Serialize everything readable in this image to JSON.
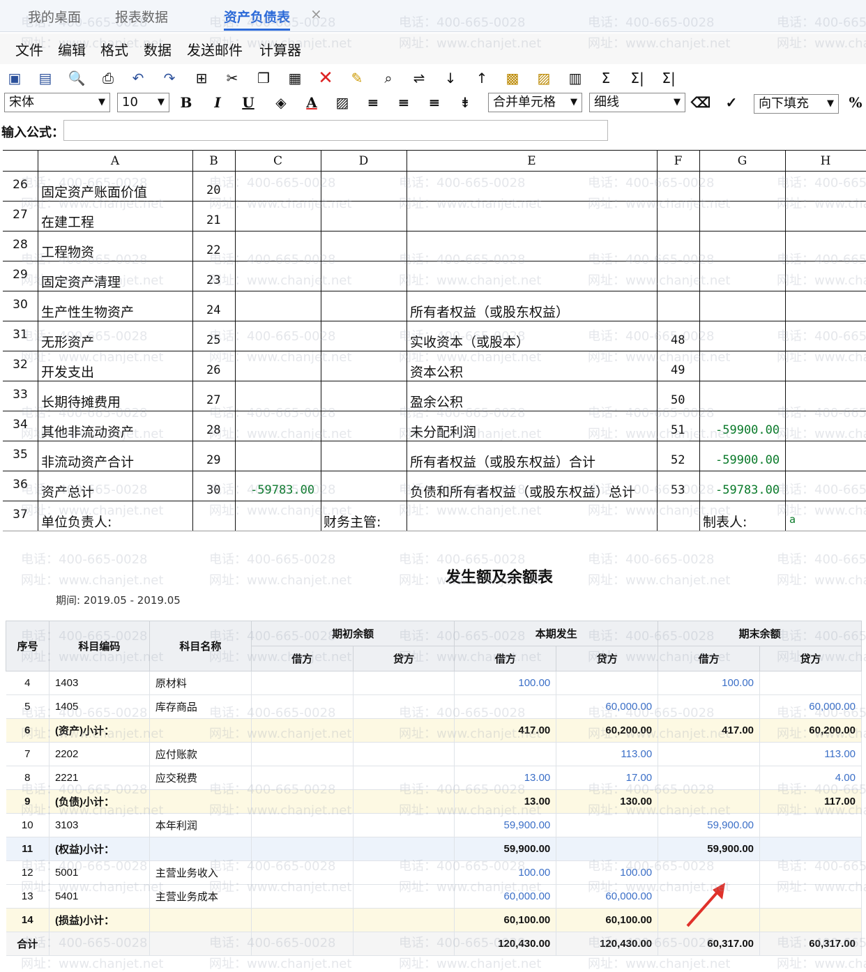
{
  "tabs": [
    {
      "label": "我的桌面"
    },
    {
      "label": "报表数据"
    },
    {
      "label": "资产负债表"
    }
  ],
  "tab_close": "×",
  "menu": [
    "文件",
    "编辑",
    "格式",
    "数据",
    "发送邮件",
    "计算器"
  ],
  "toolbar": {
    "font_name": "宋体",
    "font_size": "10",
    "bold": "B",
    "italic": "I",
    "underline": "U",
    "font_color": "A",
    "merge": "合并单元格",
    "border": "细线",
    "fill": "向下填充",
    "percent": "%",
    "sum1": "Σ",
    "sum2": "Σ|",
    "sum3": "Σ|"
  },
  "formula": {
    "label": "输入公式：",
    "value": ""
  },
  "columns": [
    "A",
    "B",
    "C",
    "D",
    "E",
    "F",
    "G",
    "H"
  ],
  "sheet_rows": [
    {
      "n": "26",
      "a": "固定资产账面价值",
      "b": "20",
      "c": "",
      "e": "",
      "f": "",
      "g": ""
    },
    {
      "n": "27",
      "a": "在建工程",
      "b": "21",
      "c": "",
      "e": "",
      "f": "",
      "g": ""
    },
    {
      "n": "28",
      "a": "工程物资",
      "b": "22",
      "c": "",
      "e": "",
      "f": "",
      "g": ""
    },
    {
      "n": "29",
      "a": "固定资产清理",
      "b": "23",
      "c": "",
      "e": "",
      "f": "",
      "g": ""
    },
    {
      "n": "30",
      "a": "生产性生物资产",
      "b": "24",
      "c": "",
      "e": "所有者权益（或股东权益）",
      "f": "",
      "g": ""
    },
    {
      "n": "31",
      "a": "无形资产",
      "b": "25",
      "c": "",
      "e": "实收资本（或股本）",
      "f": "48",
      "g": ""
    },
    {
      "n": "32",
      "a": "开发支出",
      "b": "26",
      "c": "",
      "e": "资本公积",
      "f": "49",
      "g": ""
    },
    {
      "n": "33",
      "a": "长期待摊费用",
      "b": "27",
      "c": "",
      "e": "盈余公积",
      "f": "50",
      "g": ""
    },
    {
      "n": "34",
      "a": "其他非流动资产",
      "b": "28",
      "c": "",
      "e": "未分配利润",
      "f": "51",
      "g": "-59900.00"
    },
    {
      "n": "35",
      "a": "非流动资产合计",
      "b": "29",
      "c": "",
      "e": "所有者权益（或股东权益）合计",
      "f": "52",
      "g": "-59900.00"
    },
    {
      "n": "36",
      "a": "资产总计",
      "b": "30",
      "c": "-59783.00",
      "e": "负债和所有者权益（或股东权益）总计",
      "f": "53",
      "g": "-59783.00"
    }
  ],
  "footer_row": {
    "n": "37",
    "a": "单位负责人:",
    "d": "财务主管:",
    "g": "制表人:",
    "h": "a"
  },
  "report": {
    "title": "发生额及余额表",
    "period": "期间:   2019.05 - 2019.05",
    "headers": {
      "seq": "序号",
      "code": "科目编码",
      "name": "科目名称",
      "opening": "期初余额",
      "current": "本期发生",
      "closing": "期末余额",
      "debit": "借方",
      "credit": "贷方"
    },
    "rows": [
      {
        "seq": "4",
        "code": "1403",
        "name": "原材料",
        "od": "",
        "oc": "",
        "cd": "100.00",
        "cc": "",
        "ed": "100.00",
        "ec": "",
        "type": "item"
      },
      {
        "seq": "5",
        "code": "1405",
        "name": "库存商品",
        "od": "",
        "oc": "",
        "cd": "",
        "cc": "60,000.00",
        "ed": "",
        "ec": "60,000.00",
        "type": "item"
      },
      {
        "seq": "6",
        "code": "(资产)小计：",
        "name": "",
        "od": "",
        "oc": "",
        "cd": "417.00",
        "cc": "60,200.00",
        "ed": "417.00",
        "ec": "60,200.00",
        "type": "sub"
      },
      {
        "seq": "7",
        "code": "2202",
        "name": "应付账款",
        "od": "",
        "oc": "",
        "cd": "",
        "cc": "113.00",
        "ed": "",
        "ec": "113.00",
        "type": "item"
      },
      {
        "seq": "8",
        "code": "2221",
        "name": "应交税费",
        "od": "",
        "oc": "",
        "cd": "13.00",
        "cc": "17.00",
        "ed": "",
        "ec": "4.00",
        "type": "item"
      },
      {
        "seq": "9",
        "code": "(负债)小计：",
        "name": "",
        "od": "",
        "oc": "",
        "cd": "13.00",
        "cc": "130.00",
        "ed": "",
        "ec": "117.00",
        "type": "sub"
      },
      {
        "seq": "10",
        "code": "3103",
        "name": "本年利润",
        "od": "",
        "oc": "",
        "cd": "59,900.00",
        "cc": "",
        "ed": "59,900.00",
        "ec": "",
        "type": "item"
      },
      {
        "seq": "11",
        "code": "(权益)小计：",
        "name": "",
        "od": "",
        "oc": "",
        "cd": "59,900.00",
        "cc": "",
        "ed": "59,900.00",
        "ec": "",
        "type": "sub eq"
      },
      {
        "seq": "12",
        "code": "5001",
        "name": "主营业务收入",
        "od": "",
        "oc": "",
        "cd": "100.00",
        "cc": "100.00",
        "ed": "",
        "ec": "",
        "type": "item"
      },
      {
        "seq": "13",
        "code": "5401",
        "name": "主营业务成本",
        "od": "",
        "oc": "",
        "cd": "60,000.00",
        "cc": "60,000.00",
        "ed": "",
        "ec": "",
        "type": "item"
      },
      {
        "seq": "14",
        "code": "(损益)小计：",
        "name": "",
        "od": "",
        "oc": "",
        "cd": "60,100.00",
        "cc": "60,100.00",
        "ed": "",
        "ec": "",
        "type": "sub"
      },
      {
        "seq": "合计",
        "code": "",
        "name": "",
        "od": "",
        "oc": "",
        "cd": "120,430.00",
        "cc": "120,430.00",
        "ed": "60,317.00",
        "ec": "60,317.00",
        "type": "total"
      }
    ]
  },
  "watermark": {
    "phone": "电话：400-665-0028",
    "site": "网址：www.chanjet.net"
  },
  "colors": {
    "accent": "#2c6ad8",
    "negative": "#0a7a2a",
    "link_value": "#3b6fc7",
    "arrow": "#e0312a"
  }
}
